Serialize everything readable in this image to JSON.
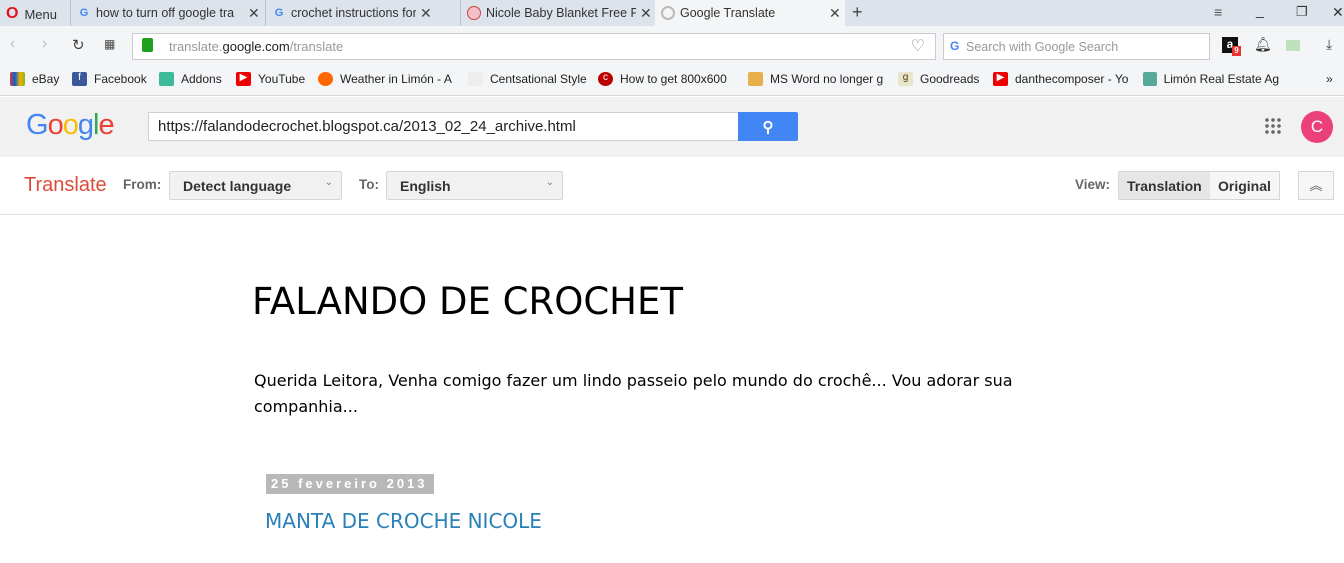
{
  "browser": {
    "menu_label": "Menu",
    "tabs": [
      {
        "title": "how to turn off google tra",
        "icon": "google-icon"
      },
      {
        "title": "crochet instructions for nic",
        "icon": "google-icon"
      },
      {
        "title": "Nicole Baby Blanket Free P",
        "icon": "site-icon"
      },
      {
        "title": "Google Translate",
        "icon": "loading-icon",
        "active": true
      }
    ],
    "new_tab": "+",
    "url_host_prefix": "translate.",
    "url_host": "google.com",
    "url_path": "/translate",
    "search_placeholder": "Search with Google Search",
    "amazon_badge": "9",
    "bookmarks": [
      "eBay",
      "Facebook",
      "Addons",
      "YouTube",
      "Weather in Limón - A",
      "Centsational Style",
      "How to get 800x600",
      "MS Word no longer g",
      "Goodreads",
      "danthecomposer - Yo",
      "Limón Real Estate Ag"
    ],
    "more": "»"
  },
  "google": {
    "logo": "Google",
    "url_input": "https://falandodecrochet.blogspot.ca/2013_02_24_archive.html",
    "avatar": "C",
    "translate_title": "Translate",
    "from_label": "From:",
    "from_value": "Detect language",
    "to_label": "To:",
    "to_value": "English",
    "view_label": "View:",
    "view_translation": "Translation",
    "view_original": "Original"
  },
  "page": {
    "title": "FALANDO DE CROCHET",
    "description": "Querida Leitora, Venha comigo fazer um lindo passeio pelo mundo do crochê... Vou adorar sua companhia...",
    "date": "25 fevereiro 2013",
    "post_title": "MANTA DE CROCHE NICOLE"
  }
}
